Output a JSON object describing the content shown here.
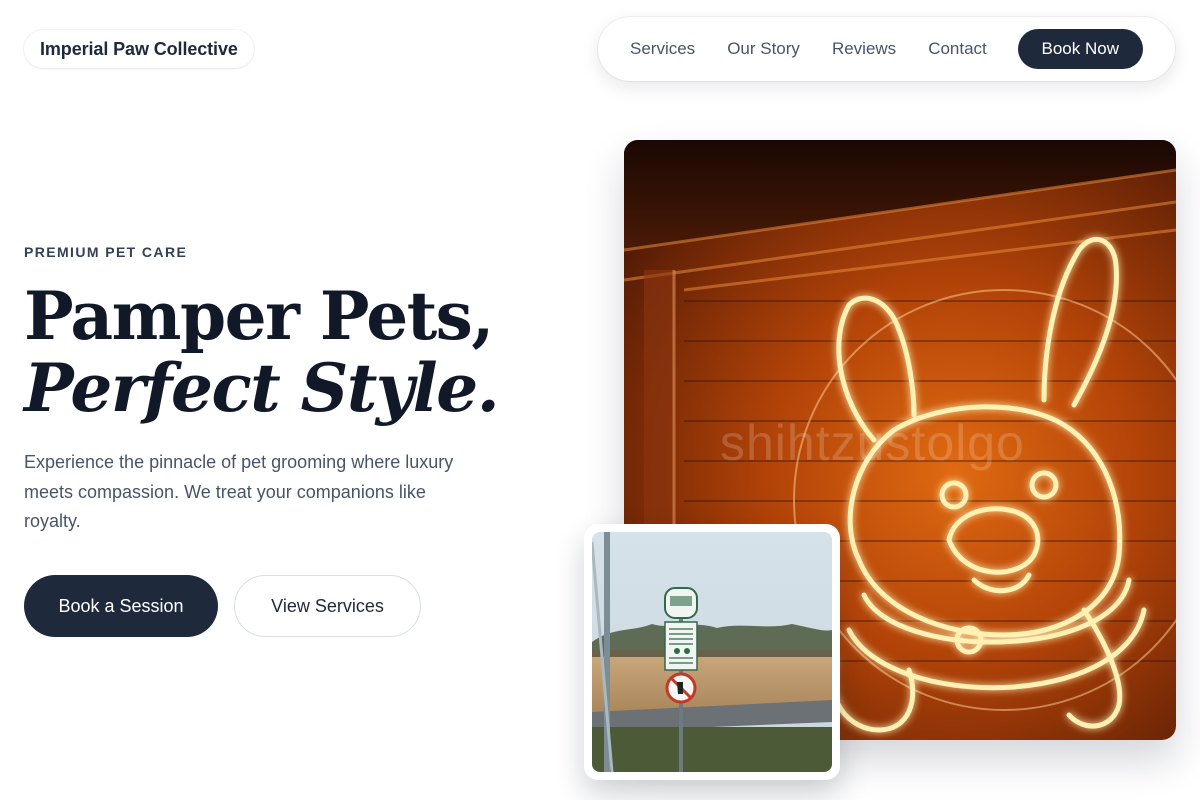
{
  "brand": {
    "name": "Imperial Paw Collective"
  },
  "nav": {
    "links": [
      "Services",
      "Our Story",
      "Reviews",
      "Contact"
    ],
    "cta": "Book Now"
  },
  "hero": {
    "eyebrow": "PREMIUM PET CARE",
    "headline_line1": "Pamper Pets,",
    "headline_line2": "Perfect Style.",
    "lead": "Experience the pinnacle of pet grooming where luxury meets compassion. We treat your companions like royalty.",
    "primary_cta": "Book a Session",
    "secondary_cta": "View Services"
  },
  "images": {
    "main": {
      "subject": "neon-dog-sign",
      "watermark": "shihtzustolgo"
    },
    "inset": {
      "subject": "park-dog-rules-sign"
    }
  },
  "colors": {
    "primary": "#1e293b",
    "text_muted": "#475569",
    "background": "#ffffff"
  }
}
